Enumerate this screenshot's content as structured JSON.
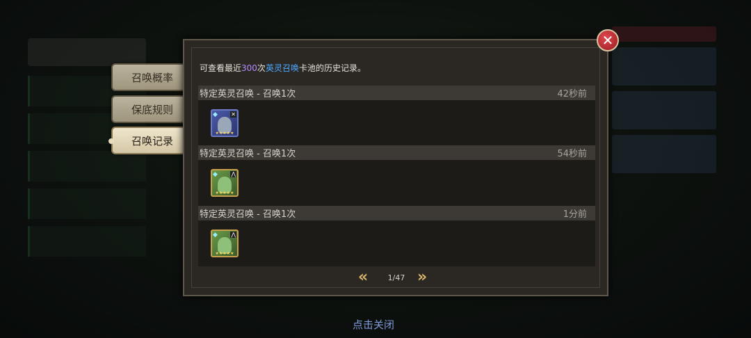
{
  "tabs": [
    {
      "label": "召唤概率",
      "active": false
    },
    {
      "label": "保底规则",
      "active": false
    },
    {
      "label": "召唤记录",
      "active": true
    }
  ],
  "notice": {
    "prefix": "可查看最近",
    "count": "300",
    "mid": "次",
    "pool": "英灵召唤",
    "suffix": "卡池的历史记录。"
  },
  "records": [
    {
      "title": "特定英灵召唤 - 召唤1次",
      "time": "42秒前",
      "hero_icon": "hero-card-blue-5star"
    },
    {
      "title": "特定英灵召唤 - 召唤1次",
      "time": "54秒前",
      "hero_icon": "hero-card-gold-5star"
    },
    {
      "title": "特定英灵召唤 - 召唤1次",
      "time": "1分前",
      "hero_icon": "hero-card-gold-5star"
    }
  ],
  "pager": {
    "text": "1/47"
  },
  "close_hint": "点击关闭",
  "colors": {
    "accent_gold": "#d7b56a",
    "count_purple": "#b58cff",
    "pool_blue": "#4ea8ff",
    "close_red": "#c8323a"
  }
}
